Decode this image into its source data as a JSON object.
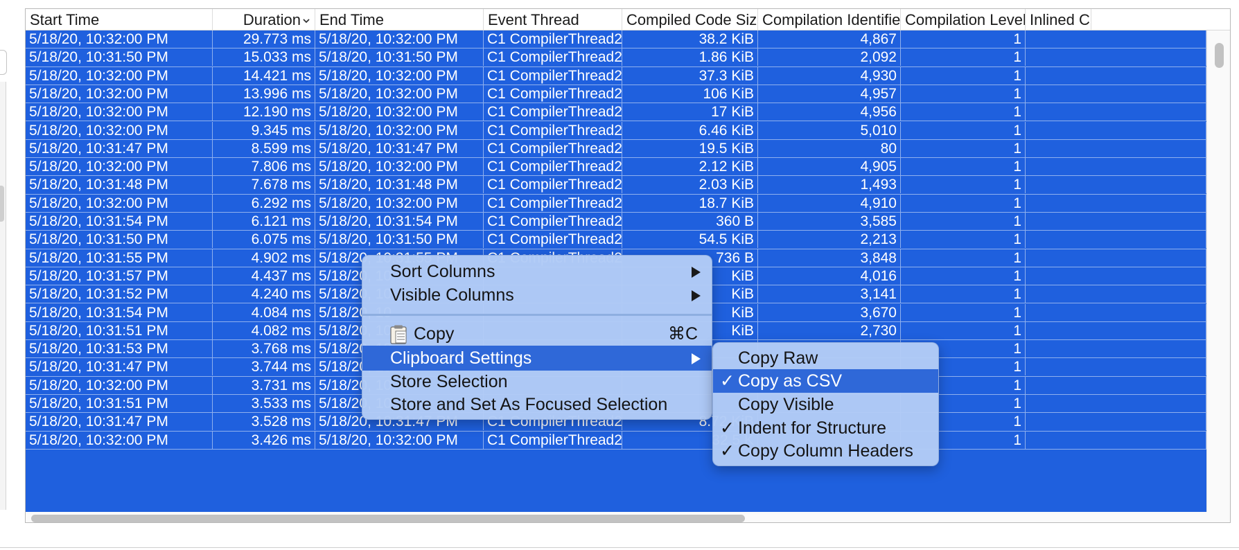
{
  "table": {
    "columns": [
      "Start Time",
      "Duration",
      "End Time",
      "Event Thread",
      "Compiled Code Size",
      "Compilation Identifier",
      "Compilation Level",
      "Inlined C"
    ],
    "rows": [
      [
        "5/18/20, 10:32:00 PM",
        "29.773 ms",
        "5/18/20, 10:32:00 PM",
        "C1 CompilerThread2",
        "38.2 KiB",
        "4,867",
        "1",
        ""
      ],
      [
        "5/18/20, 10:31:50 PM",
        "15.033 ms",
        "5/18/20, 10:31:50 PM",
        "C1 CompilerThread2",
        "1.86 KiB",
        "2,092",
        "1",
        ""
      ],
      [
        "5/18/20, 10:32:00 PM",
        "14.421 ms",
        "5/18/20, 10:32:00 PM",
        "C1 CompilerThread2",
        "37.3 KiB",
        "4,930",
        "1",
        ""
      ],
      [
        "5/18/20, 10:32:00 PM",
        "13.996 ms",
        "5/18/20, 10:32:00 PM",
        "C1 CompilerThread2",
        "106 KiB",
        "4,957",
        "1",
        ""
      ],
      [
        "5/18/20, 10:32:00 PM",
        "12.190 ms",
        "5/18/20, 10:32:00 PM",
        "C1 CompilerThread2",
        "17 KiB",
        "4,956",
        "1",
        ""
      ],
      [
        "5/18/20, 10:32:00 PM",
        "9.345 ms",
        "5/18/20, 10:32:00 PM",
        "C1 CompilerThread2",
        "6.46 KiB",
        "5,010",
        "1",
        ""
      ],
      [
        "5/18/20, 10:31:47 PM",
        "8.599 ms",
        "5/18/20, 10:31:47 PM",
        "C1 CompilerThread2",
        "19.5 KiB",
        "80",
        "1",
        ""
      ],
      [
        "5/18/20, 10:32:00 PM",
        "7.806 ms",
        "5/18/20, 10:32:00 PM",
        "C1 CompilerThread2",
        "2.12 KiB",
        "4,905",
        "1",
        ""
      ],
      [
        "5/18/20, 10:31:48 PM",
        "7.678 ms",
        "5/18/20, 10:31:48 PM",
        "C1 CompilerThread2",
        "2.03 KiB",
        "1,493",
        "1",
        ""
      ],
      [
        "5/18/20, 10:32:00 PM",
        "6.292 ms",
        "5/18/20, 10:32:00 PM",
        "C1 CompilerThread2",
        "18.7 KiB",
        "4,910",
        "1",
        ""
      ],
      [
        "5/18/20, 10:31:54 PM",
        "6.121 ms",
        "5/18/20, 10:31:54 PM",
        "C1 CompilerThread2",
        "360 B",
        "3,585",
        "1",
        ""
      ],
      [
        "5/18/20, 10:31:50 PM",
        "6.075 ms",
        "5/18/20, 10:31:50 PM",
        "C1 CompilerThread2",
        "54.5 KiB",
        "2,213",
        "1",
        ""
      ],
      [
        "5/18/20, 10:31:55 PM",
        "4.902 ms",
        "5/18/20, 10:31:55 PM",
        "C1 CompilerThread2",
        "736 B",
        "3,848",
        "1",
        ""
      ],
      [
        "5/18/20, 10:31:57 PM",
        "4.437 ms",
        "5/18/20, 10",
        "",
        "KiB",
        "4,016",
        "1",
        ""
      ],
      [
        "5/18/20, 10:31:52 PM",
        "4.240 ms",
        "5/18/20, 10",
        "",
        "KiB",
        "3,141",
        "1",
        ""
      ],
      [
        "5/18/20, 10:31:54 PM",
        "4.084 ms",
        "5/18/20, 10",
        "",
        "KiB",
        "3,670",
        "1",
        ""
      ],
      [
        "5/18/20, 10:31:51 PM",
        "4.082 ms",
        "5/18/20, 10",
        "",
        "KiB",
        "2,730",
        "1",
        ""
      ],
      [
        "5/18/20, 10:31:53 PM",
        "3.768 ms",
        "5/18/20, 10",
        "",
        "",
        "",
        "1",
        ""
      ],
      [
        "5/18/20, 10:31:47 PM",
        "3.744 ms",
        "5/18/20, 10",
        "",
        "",
        "",
        "1",
        ""
      ],
      [
        "5/18/20, 10:32:00 PM",
        "3.731 ms",
        "5/18/20, 10",
        "",
        "",
        "",
        "1",
        ""
      ],
      [
        "5/18/20, 10:31:51 PM",
        "3.533 ms",
        "5/18/20, 10",
        "",
        "",
        "",
        "1",
        ""
      ],
      [
        "5/18/20, 10:31:47 PM",
        "3.528 ms",
        "5/18/20, 10:31:47 PM",
        "C1 CompilerThread2",
        "8.72 KiB",
        "",
        "1",
        ""
      ],
      [
        "5/18/20, 10:32:00 PM",
        "3.426 ms",
        "5/18/20, 10:32:00 PM",
        "C1 CompilerThread2",
        "32.5 K",
        "",
        "1",
        ""
      ]
    ]
  },
  "context_menu": {
    "items": [
      {
        "label": "Sort Columns"
      },
      {
        "label": "Visible Columns"
      },
      {
        "label": "Copy",
        "shortcut": "⌘C"
      },
      {
        "label": "Clipboard Settings"
      },
      {
        "label": "Store Selection"
      },
      {
        "label": "Store and Set As Focused Selection"
      }
    ]
  },
  "submenu": {
    "items": [
      {
        "label": "Copy Raw",
        "checked": ""
      },
      {
        "label": "Copy as CSV",
        "checked": "✓"
      },
      {
        "label": "Copy Visible",
        "checked": ""
      },
      {
        "label": "Indent for Structure",
        "checked": "✓"
      },
      {
        "label": "Copy Column Headers",
        "checked": "✓"
      }
    ]
  },
  "colors": {
    "selection": "#1f60de",
    "menu_bg": "#b2cbf6",
    "menu_highlight": "#2f68d8"
  }
}
